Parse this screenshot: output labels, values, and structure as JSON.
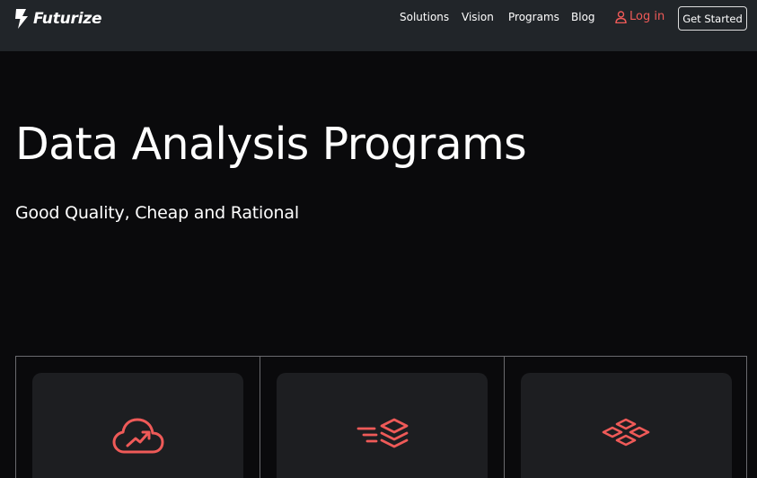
{
  "brand": {
    "name": "Futurize",
    "logo_icon": "lightning-bolt-icon"
  },
  "nav": {
    "links": [
      "Solutions",
      "Vision",
      "Programs",
      "Blog"
    ],
    "login_label": "Log in",
    "login_icon": "user-icon",
    "cta_label": "Get Started"
  },
  "hero": {
    "title": "Data Analysis Programs",
    "subtitle": "Good Quality, Cheap and Rational"
  },
  "cards": [
    {
      "icon": "cloud-trend-icon"
    },
    {
      "icon": "fast-layers-icon"
    },
    {
      "icon": "diamond-grid-icon"
    }
  ],
  "colors": {
    "accent": "#ef5a58",
    "nav_bg": "#212529",
    "page_bg": "#0a0a0c",
    "card_bg": "#1d1e21"
  }
}
